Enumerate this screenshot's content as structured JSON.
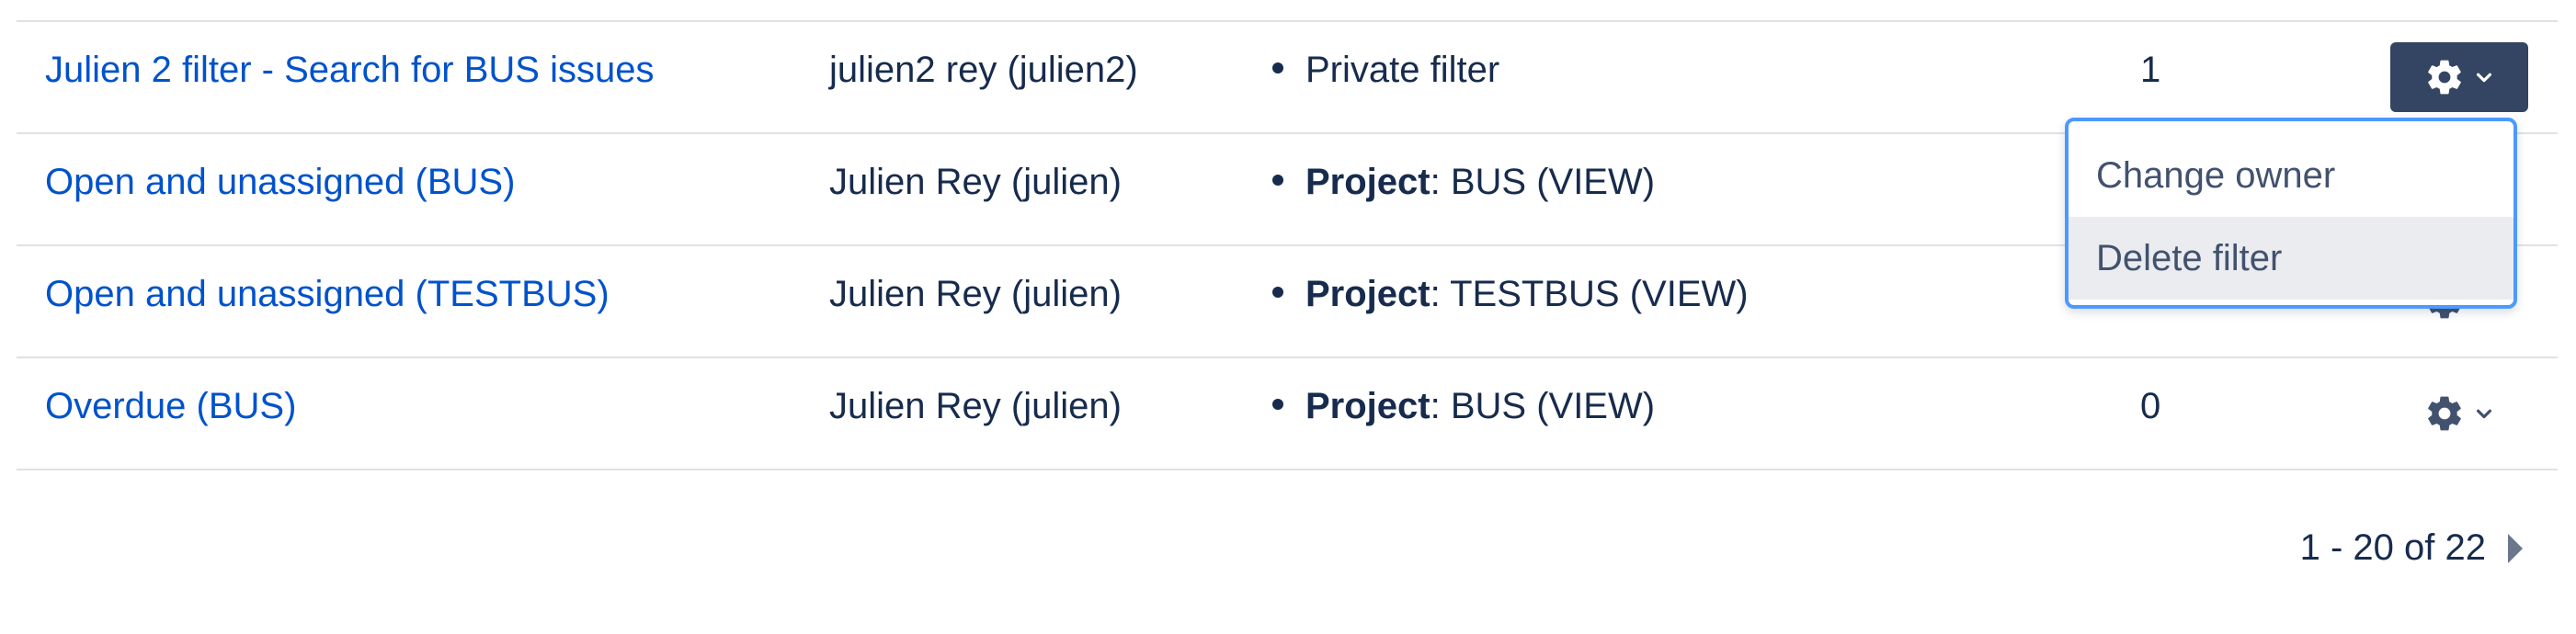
{
  "filters": [
    {
      "name": "Julien 2 filter - Search for BUS issues",
      "owner": "julien2 rey (julien2)",
      "share_label": "",
      "share_value": "Private filter",
      "favourites": "1"
    },
    {
      "name": "Open and unassigned (BUS)",
      "owner": "Julien Rey (julien)",
      "share_label": "Project",
      "share_value": ": BUS (VIEW)",
      "favourites": ""
    },
    {
      "name": "Open and unassigned (TESTBUS)",
      "owner": "Julien Rey (julien)",
      "share_label": "Project",
      "share_value": ": TESTBUS (VIEW)",
      "favourites": ""
    },
    {
      "name": "Overdue (BUS)",
      "owner": "Julien Rey (julien)",
      "share_label": "Project",
      "share_value": ": BUS (VIEW)",
      "favourites": "0"
    }
  ],
  "actions_menu": {
    "items": [
      "Change owner",
      "Delete filter"
    ],
    "hovered_item": "Delete filter"
  },
  "pagination": {
    "range": "1 - 20 of 22"
  },
  "icons": {
    "actions": "gear-icon",
    "dropdown": "chevron-down-icon",
    "next": "chevron-right-icon"
  },
  "colors": {
    "link": "#0052cc",
    "active_button": "#344563",
    "dropdown_border": "#4c9aff"
  }
}
